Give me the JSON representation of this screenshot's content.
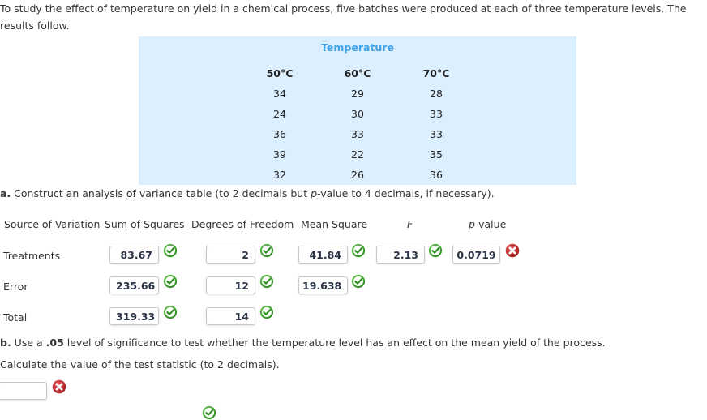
{
  "intro_text": "To study the effect of temperature on yield in a chemical process, five batches were produced at each of three temperature levels. The results follow.",
  "data_table": {
    "title": "Temperature",
    "columns": [
      "50°C",
      "60°C",
      "70°C"
    ],
    "rows": [
      [
        "34",
        "29",
        "28"
      ],
      [
        "24",
        "30",
        "33"
      ],
      [
        "36",
        "33",
        "33"
      ],
      [
        "39",
        "22",
        "35"
      ],
      [
        "32",
        "26",
        "36"
      ]
    ]
  },
  "part_a": {
    "label": "a.",
    "text": " Construct an analysis of variance table (to 2 decimals but ",
    "p_italic": "p",
    "text2": "-value to 4 decimals, if necessary)."
  },
  "anova": {
    "headers": {
      "source": "Source of Variation",
      "ss": "Sum of Squares",
      "df": "Degrees of Freedom",
      "ms": "Mean Square",
      "f": "F",
      "p_italic": "p",
      "p_rest": "-value"
    },
    "rows": [
      {
        "label": "Treatments",
        "ss": "83.67",
        "ss_status": "correct",
        "df": "2",
        "df_status": "correct",
        "ms": "41.84",
        "ms_status": "correct",
        "f": "2.13",
        "f_status": "correct",
        "p": "0.0719",
        "p_status": "incorrect"
      },
      {
        "label": "Error",
        "ss": "235.66",
        "ss_status": "correct",
        "df": "12",
        "df_status": "correct",
        "ms": "19.638",
        "ms_status": "correct"
      },
      {
        "label": "Total",
        "ss": "319.33",
        "ss_status": "correct",
        "df": "14",
        "df_status": "correct"
      }
    ]
  },
  "part_b": {
    "label": "b.",
    "text1": " Use a ",
    "alpha": ".05",
    "text2": " level of significance to test whether the temperature level has an effect on the mean yield of the process.",
    "calc_text": "Calculate the value of the test statistic (to 2 decimals).",
    "test_statistic_value": "",
    "test_statistic_status": "incorrect"
  },
  "colors": {
    "correct": "#3a9a2a",
    "incorrect": "#c0282a",
    "panel_bg": "#dcefff",
    "accent": "#3fa3e8"
  }
}
